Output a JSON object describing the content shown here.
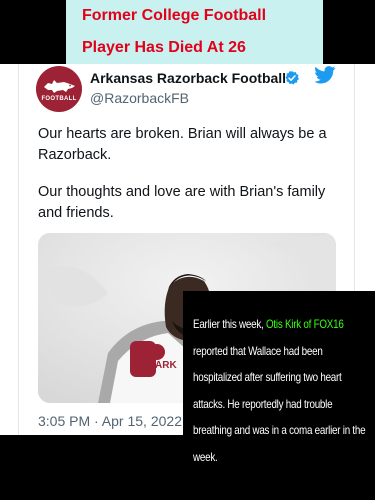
{
  "headline": {
    "line1": "Former College Football",
    "line2": "Player Has Died At 26"
  },
  "tweet": {
    "account_name": "Arkansas Razorback Football",
    "handle": "@RazorbackFB",
    "avatar_text": "FOOTBALL",
    "paragraph1": "Our hearts are broken. Brian will always be a Razorback.",
    "paragraph2": "Our thoughts and love are with Brian's family and friends.",
    "jersey_text": "ARK",
    "timestamp": "3:05 PM · Apr 15, 2022"
  },
  "caption": {
    "part1": "Earlier this week, ",
    "highlight": "Otis Kirk of FOX16",
    "part2": " reported that Wallace had been hospitalized after suffering two heart attacks. He reportedly had trouble breathing and was in a coma earlier in the week."
  },
  "colors": {
    "headline_bg": "#c9f1ef",
    "headline_text": "#e3001b",
    "razorback_red": "#9d2235",
    "twitter_blue": "#1d9bf0",
    "caption_highlight": "#39ff14"
  }
}
